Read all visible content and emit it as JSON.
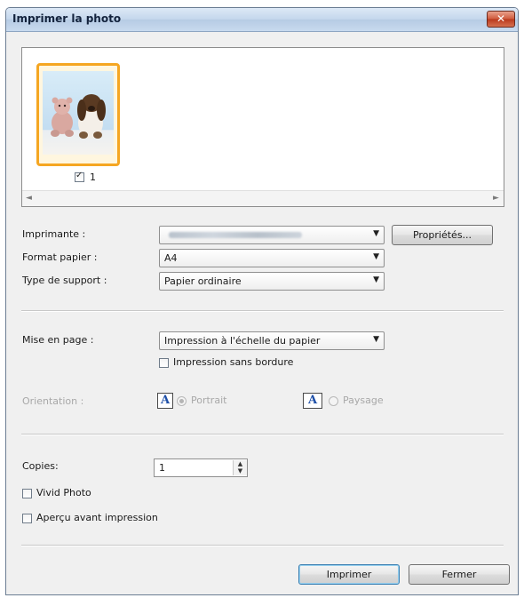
{
  "window": {
    "title": "Imprimer la photo",
    "close_glyph": "✕"
  },
  "preview": {
    "thumbnails": [
      {
        "checked": true,
        "number": "1"
      }
    ]
  },
  "printer": {
    "label": "Imprimante :",
    "value": "",
    "properties_button": "Propriétés..."
  },
  "paper_size": {
    "label": "Format papier :",
    "value": "A4"
  },
  "media_type": {
    "label": "Type de support :",
    "value": "Papier ordinaire"
  },
  "layout": {
    "label": "Mise en page :",
    "value": "Impression à l'échelle du papier",
    "borderless_label": "Impression sans bordure",
    "borderless_checked": false
  },
  "orientation": {
    "label": "Orientation :",
    "portrait_label": "Portrait",
    "landscape_label": "Paysage",
    "selected": "portrait",
    "icon_letter": "A"
  },
  "copies": {
    "label": "Copies:",
    "value": "1",
    "vivid_label": "Vivid Photo",
    "vivid_checked": false,
    "preview_label": "Aperçu avant impression",
    "preview_checked": false
  },
  "buttons": {
    "print": "Imprimer",
    "close": "Fermer"
  },
  "icons": {
    "dropdown": "▼",
    "scroll_left": "◄",
    "scroll_right": "►",
    "spin_up": "▲",
    "spin_down": "▼"
  },
  "colors": {
    "thumbnail_highlight": "#f5a622",
    "default_button_border": "#3c7fb1"
  }
}
